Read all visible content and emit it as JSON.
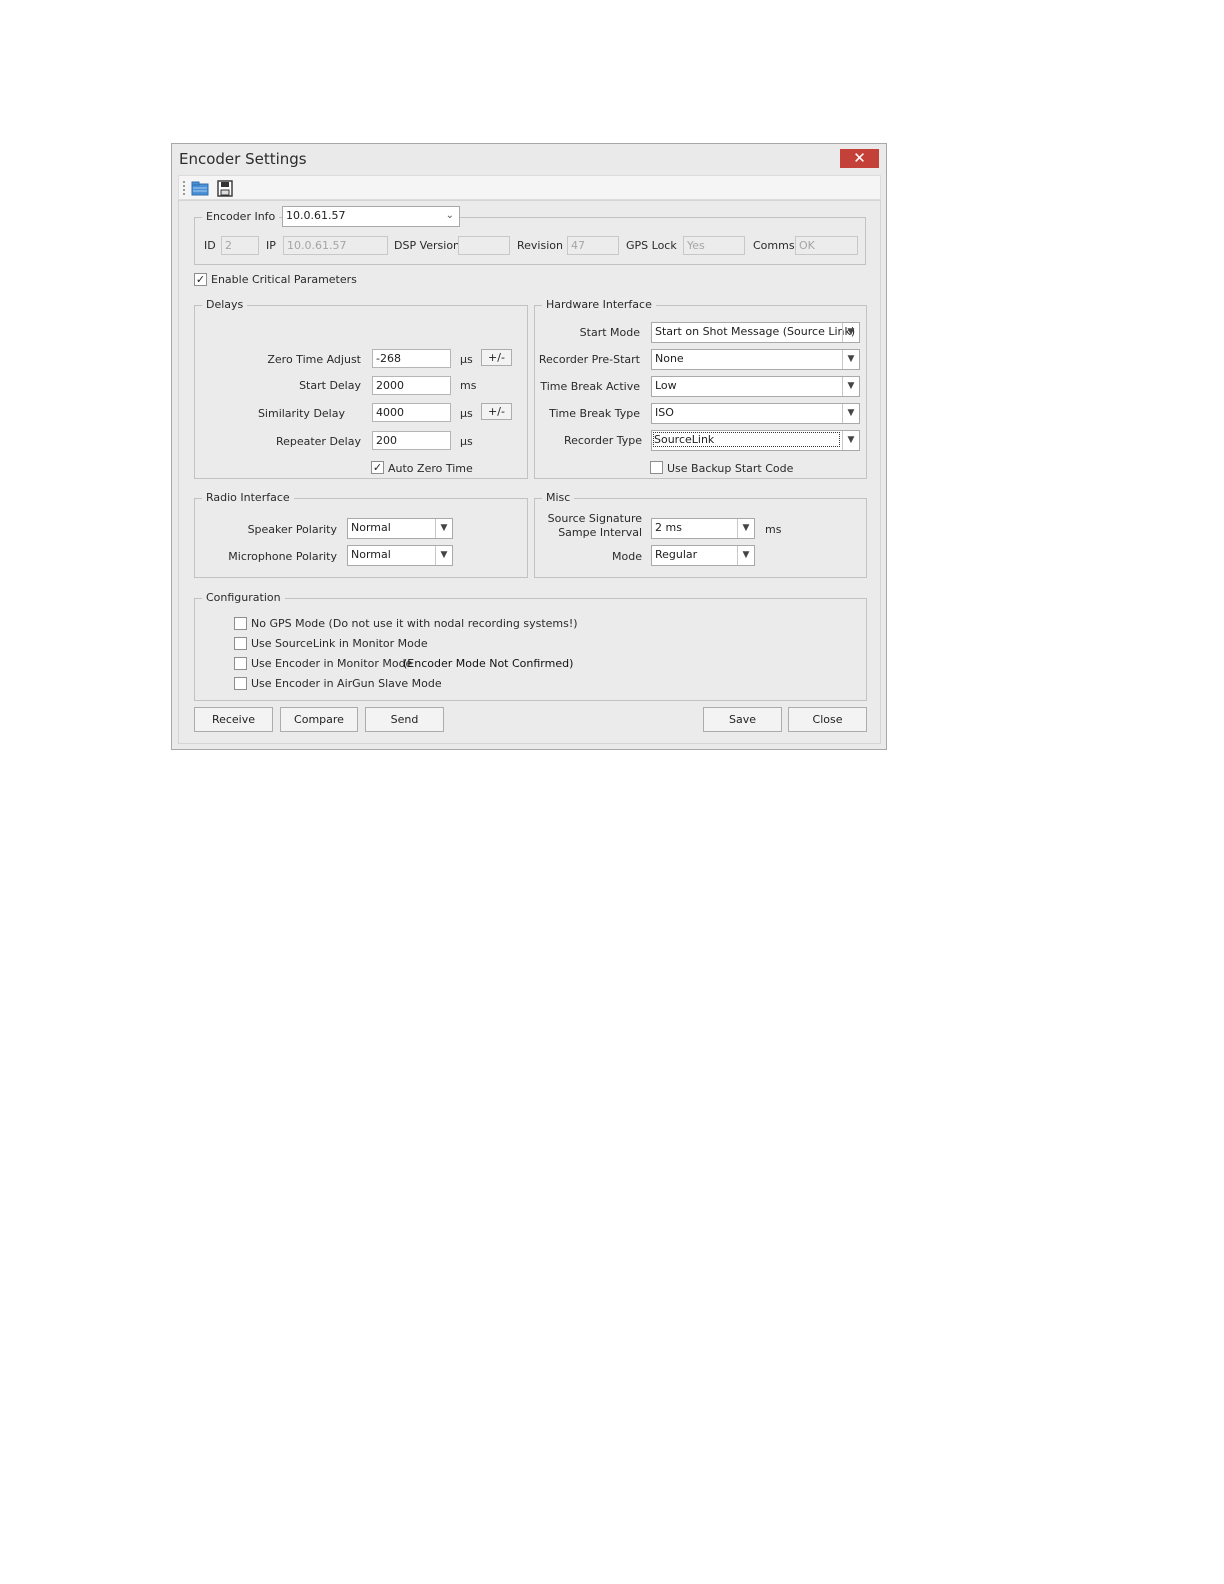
{
  "window": {
    "title": "Encoder Settings",
    "close_glyph": "✕"
  },
  "toolbar": {
    "icons": [
      "open-folder-icon",
      "save-disk-icon"
    ]
  },
  "encoder_info": {
    "legend": "Encoder Info",
    "selected": "10.0.61.57",
    "id_label": "ID",
    "id_value": "2",
    "ip_label": "IP",
    "ip_value": "10.0.61.57",
    "dsp_label": "DSP Version",
    "dsp_value": "",
    "revision_label": "Revision",
    "revision_value": "47",
    "gps_label": "GPS Lock",
    "gps_value": "Yes",
    "comms_label": "Comms",
    "comms_value": "OK"
  },
  "critical": {
    "label": "Enable Critical Parameters",
    "checked": true
  },
  "delays": {
    "legend": "Delays",
    "zero_time_label": "Zero Time Adjust",
    "zero_time_value": "-268",
    "zero_time_unit": "µs",
    "start_delay_label": "Start Delay",
    "start_delay_value": "2000",
    "start_delay_unit": "ms",
    "similarity_label": "Similarity Delay",
    "similarity_value": "4000",
    "similarity_unit": "µs",
    "repeater_label": "Repeater Delay",
    "repeater_value": "200",
    "repeater_unit": "µs",
    "plus_minus": "+/-",
    "auto_zero_label": "Auto Zero Time",
    "auto_zero_checked": true
  },
  "hardware": {
    "legend": "Hardware Interface",
    "start_mode_label": "Start Mode",
    "start_mode_value": "Start on Shot Message (Source Link)",
    "pre_start_label": "Recorder Pre-Start",
    "pre_start_value": "None",
    "tb_active_label": "Time Break Active",
    "tb_active_value": "Low",
    "tb_type_label": "Time Break Type",
    "tb_type_value": "ISO",
    "rec_type_label": "Recorder Type",
    "rec_type_value": "SourceLink",
    "backup_label": "Use Backup Start Code",
    "backup_checked": false
  },
  "radio": {
    "legend": "Radio Interface",
    "speaker_label": "Speaker Polarity",
    "speaker_value": "Normal",
    "mic_label": "Microphone Polarity",
    "mic_value": "Normal"
  },
  "misc": {
    "legend": "Misc",
    "interval_label_1": "Source Signature",
    "interval_label_2": "Sampe Interval",
    "interval_value": "2 ms",
    "interval_unit": "ms",
    "mode_label": "Mode",
    "mode_value": "Regular"
  },
  "configuration": {
    "legend": "Configuration",
    "no_gps": "No GPS Mode (Do not use it with nodal recording systems!)",
    "sourcelink_monitor": "Use SourceLink in Monitor Mode",
    "encoder_monitor": "Use Encoder in Monitor Mode",
    "encoder_monitor_note": "(Encoder Mode Not Confirmed)",
    "airgun_slave": "Use Encoder in AirGun Slave Mode"
  },
  "buttons": {
    "receive": "Receive",
    "compare": "Compare",
    "send": "Send",
    "save": "Save",
    "close": "Close"
  },
  "colors": {
    "close_red": "#c4413a",
    "dialog_bg": "#eaeaea",
    "folder_blue": "#4a90d6"
  }
}
